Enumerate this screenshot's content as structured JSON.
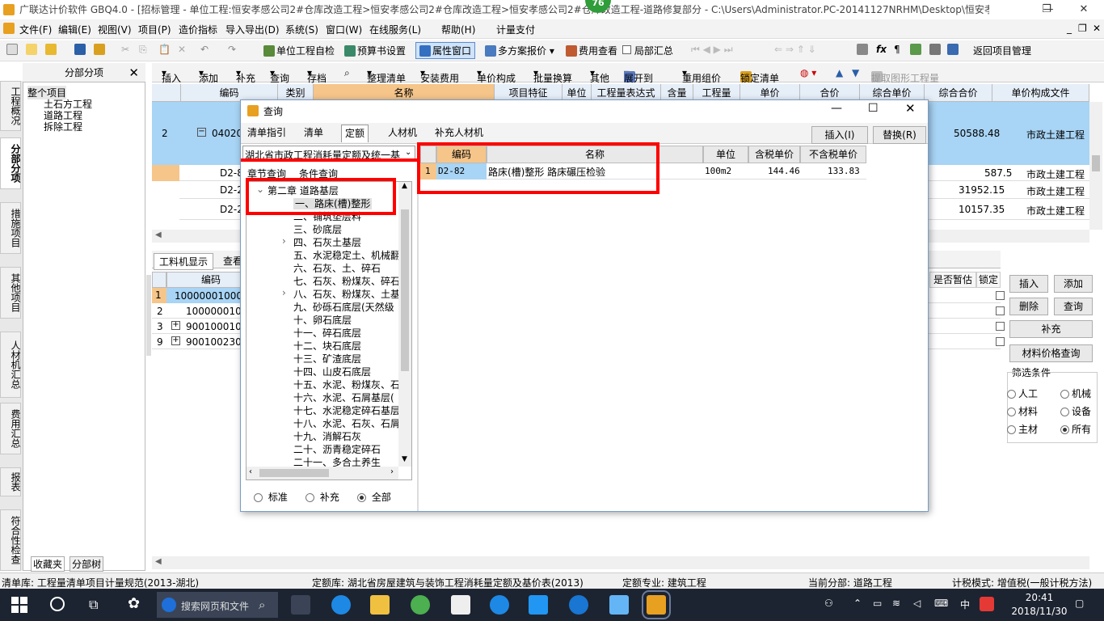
{
  "window": {
    "title": "广联达计价软件 GBQ4.0 - [招标管理 - 单位工程:恒安孝感公司2#仓库改造工程>恒安孝感公司2#仓库改造工程>恒安孝感公司2#仓库改造工程-道路修复部分 - C:\\Users\\Administrator.PC-20141127NRHM\\Desktop\\恒安孝...",
    "badge": "76",
    "minimize": "—",
    "restore": "❐",
    "close": "✕",
    "inner_minimize": "_",
    "inner_restore": "❐",
    "inner_close": "✕"
  },
  "menu": [
    "文件(F)",
    "编辑(E)",
    "视图(V)",
    "项目(P)",
    "造价指标",
    "导入导出(D)",
    "系统(S)",
    "窗口(W)",
    "在线服务(L)",
    "帮助(H)",
    "计量支付"
  ],
  "toolbar1": {
    "self_check": "单位工程自检",
    "budget_setting": "预算书设置",
    "property_window": "属性窗口",
    "multi_plan": "多方案报价",
    "fee_view": "费用查看",
    "local_summary": "局部汇总",
    "return_project": "返回项目管理"
  },
  "left_tabs": [
    "工程概况",
    "分部分项",
    "措施项目",
    "其他项目",
    "人材机汇总",
    "费用汇总",
    "报表",
    "符合性检查"
  ],
  "tree_panel": {
    "header": "分部分项",
    "close": "✕",
    "items": [
      "整个项目",
      "土石方工程",
      "道路工程",
      "拆除工程"
    ],
    "bottom_tabs": [
      "收藏夹",
      "分部树"
    ]
  },
  "toolbar2": [
    "插入",
    "添加",
    "补充",
    "查询",
    "存档",
    "整理清单",
    "安装费用",
    "单价构成",
    "批量换算",
    "其他",
    "展开到",
    "重用组价",
    "锁定清单",
    "提取图形工程量"
  ],
  "grid": {
    "headers": [
      "编码",
      "类别",
      "名称",
      "项目特征",
      "单位",
      "工程量表达式",
      "含量",
      "工程量",
      "单价",
      "合价",
      "综合单价",
      "综合合价",
      "单价构成文件"
    ],
    "rows": [
      {
        "no": "2",
        "code": "040203",
        "total": "50588.48",
        "file": "市政土建工程"
      },
      {
        "no": "",
        "code": "D2-8",
        "total": "587.5",
        "file": "市政土建工程"
      },
      {
        "no": "",
        "code": "D2-2",
        "total": "31952.15",
        "file": "市政土建工程"
      },
      {
        "no": "",
        "code": "D2-2",
        "total": "10157.35",
        "file": "市政土建工程"
      }
    ]
  },
  "lower_panel": {
    "tabs": [
      "工料机显示",
      "查看"
    ],
    "headers": [
      "编码",
      "是否暂估",
      "锁定"
    ],
    "rows": [
      {
        "no": "1",
        "code": "10000001000"
      },
      {
        "no": "2",
        "code": "10000001002"
      },
      {
        "no": "3",
        "code": "900100010005"
      },
      {
        "no": "9",
        "code": "900100230000"
      }
    ],
    "buttons": {
      "insert": "插入",
      "add": "添加",
      "delete": "删除",
      "query": "查询",
      "supplement": "补充",
      "price_query": "材料价格查询"
    },
    "filter": {
      "title": "筛选条件",
      "options": [
        "人工",
        "机械",
        "材料",
        "设备",
        "主材",
        "所有"
      ],
      "selected": "所有"
    }
  },
  "dialog": {
    "title": "查询",
    "tabs": [
      "清单指引",
      "清单",
      "定额",
      "人材机",
      "补充人材机"
    ],
    "active_tab": "定额",
    "insert_button": "插入(I)",
    "replace_button": "替换(R)",
    "library_select": "湖北省市政工程消耗量定额及统一基",
    "search_tabs": [
      "章节查询",
      "条件查询"
    ],
    "chapter_tree": [
      {
        "text": "第二章  道路基层",
        "level": 0,
        "expanded": true
      },
      {
        "text": "一、路床(槽)整形",
        "level": 1,
        "selected": true
      },
      {
        "text": "二、铺筑垫层料",
        "level": 1
      },
      {
        "text": "三、砂底层",
        "level": 1
      },
      {
        "text": "四、石灰土基层",
        "level": 1,
        "expandable": true
      },
      {
        "text": "五、水泥稳定土、机械翻",
        "level": 1
      },
      {
        "text": "六、石灰、土、碎石",
        "level": 1
      },
      {
        "text": "七、石灰、粉煤灰、碎石",
        "level": 1
      },
      {
        "text": "八、石灰、粉煤灰、土基",
        "level": 1,
        "expandable": true
      },
      {
        "text": "九、砂砾石底层(天然级",
        "level": 1
      },
      {
        "text": "十、卵石底层",
        "level": 1
      },
      {
        "text": "十一、碎石底层",
        "level": 1
      },
      {
        "text": "十二、块石底层",
        "level": 1
      },
      {
        "text": "十三、矿渣底层",
        "level": 1
      },
      {
        "text": "十四、山皮石底层",
        "level": 1
      },
      {
        "text": "十五、水泥、粉煤灰、石",
        "level": 1
      },
      {
        "text": "十六、水泥、石屑基层(",
        "level": 1
      },
      {
        "text": "十七、水泥稳定碎石基层",
        "level": 1
      },
      {
        "text": "十八、水泥、石灰、石屑",
        "level": 1
      },
      {
        "text": "十九、消解石灰",
        "level": 1
      },
      {
        "text": "二十、沥青稳定碎石",
        "level": 1
      },
      {
        "text": "二十一、多合土养生",
        "level": 1
      }
    ],
    "radio": {
      "options": [
        "标准",
        "补充",
        "全部"
      ],
      "selected": "全部"
    },
    "result_headers": [
      "编码",
      "名称",
      "单位",
      "含税单价",
      "不含税单价"
    ],
    "results": [
      {
        "no": "1",
        "code": "D2-82",
        "name": "路床(槽)整形 路床碾压检验",
        "unit": "100m2",
        "tax_price": "144.46",
        "notax_price": "133.83"
      }
    ]
  },
  "statusbar": {
    "list_lib": "清单库:  工程量清单项目计量规范(2013-湖北)",
    "quota_lib": "定额库:  湖北省房屋建筑与装饰工程消耗量定额及基价表(2013)",
    "quota_major": "定额专业:  建筑工程",
    "current_part": "当前分部:  道路工程",
    "tax_mode": "计税模式:  增值税(一般计税方法)"
  },
  "taskbar": {
    "search_placeholder": "搜索网页和文件",
    "time": "20:41",
    "date": "2018/11/30",
    "ime": "中"
  },
  "colors": {
    "highlight_row": "#a8d4f5",
    "red_annotation": "#ff0000",
    "taskbar": "#1c2431"
  }
}
